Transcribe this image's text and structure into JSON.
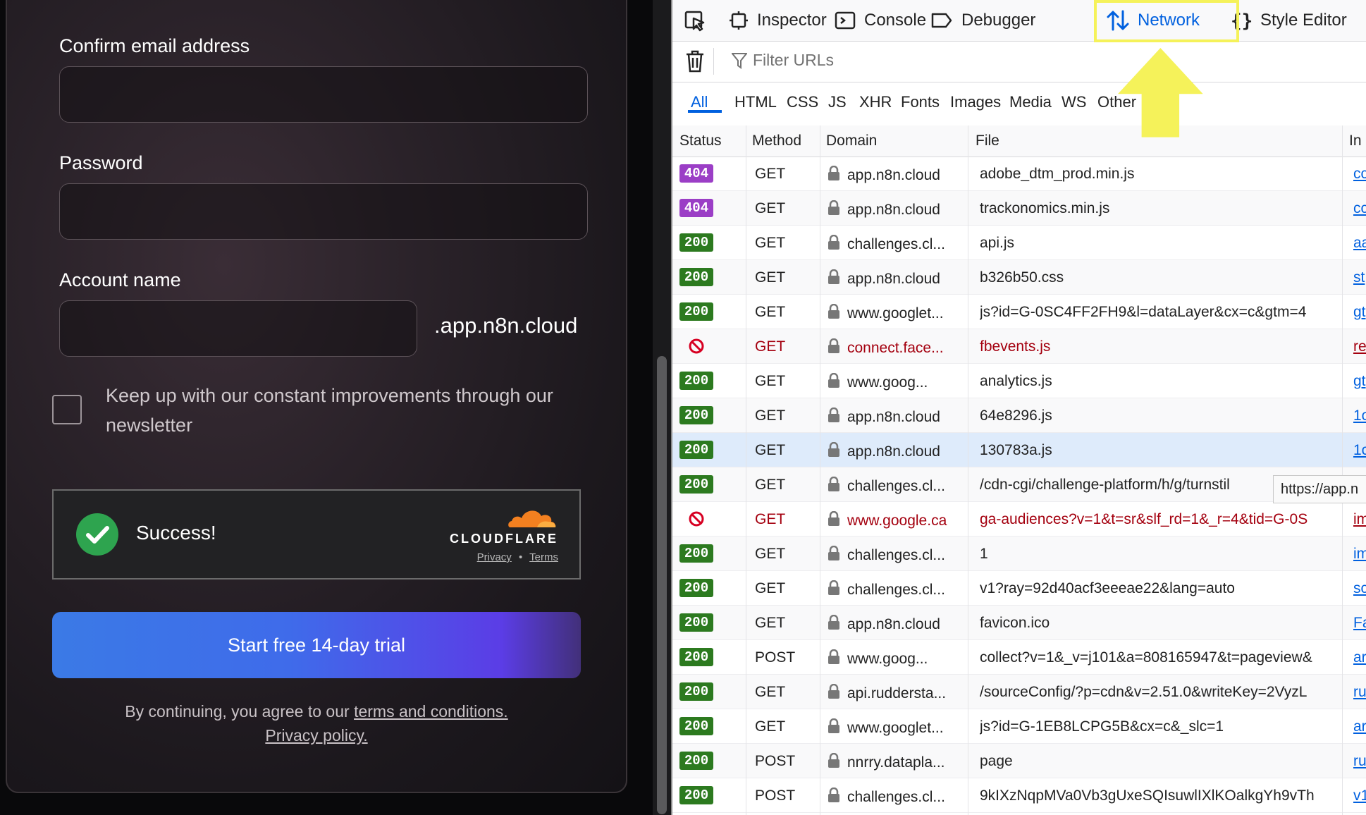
{
  "signup": {
    "confirm_email_label": "Confirm email address",
    "password_label": "Password",
    "account_name_label": "Account name",
    "account_suffix": ".app.n8n.cloud",
    "newsletter_text": "Keep up with our constant improvements through our newsletter",
    "captcha": {
      "status": "Success!",
      "brand": "CLOUDFLARE",
      "privacy": "Privacy",
      "separator": "•",
      "terms": "Terms"
    },
    "submit_label": "Start free 14-day trial",
    "agree_prefix": "By continuing, you agree to our",
    "terms_link": "terms and conditions.",
    "privacy_link": "Privacy policy."
  },
  "devtools": {
    "tabs": {
      "inspector": "Inspector",
      "console": "Console",
      "debugger": "Debugger",
      "network": "Network",
      "style_editor": "Style Editor"
    },
    "filter_placeholder": "Filter URLs",
    "types": {
      "all": "All",
      "html": "HTML",
      "css": "CSS",
      "js": "JS",
      "xhr": "XHR",
      "fonts": "Fonts",
      "images": "Images",
      "media": "Media",
      "ws": "WS",
      "other": "Other"
    },
    "columns": {
      "status": "Status",
      "method": "Method",
      "domain": "Domain",
      "file": "File",
      "initiator": "In"
    },
    "tooltip": "https://app.n",
    "requests": [
      {
        "status": "404",
        "method": "GET",
        "domain": "app.n8n.cloud",
        "file": "adobe_dtm_prod.min.js",
        "initiator": "cc"
      },
      {
        "status": "404",
        "method": "GET",
        "domain": "app.n8n.cloud",
        "file": "trackonomics.min.js",
        "initiator": "cc"
      },
      {
        "status": "200",
        "method": "GET",
        "domain": "challenges.cl...",
        "file": "api.js",
        "initiator": "aa"
      },
      {
        "status": "200",
        "method": "GET",
        "domain": "app.n8n.cloud",
        "file": "b326b50.css",
        "initiator": "st"
      },
      {
        "status": "200",
        "method": "GET",
        "domain": "www.googlet...",
        "file": "js?id=G-0SC4FF2FH9&l=dataLayer&cx=c&gtm=4",
        "initiator": "gt"
      },
      {
        "status": "blocked",
        "method": "GET",
        "domain": "connect.face...",
        "file": "fbevents.js",
        "initiator": "re"
      },
      {
        "status": "200",
        "method": "GET",
        "domain": "www.goog...",
        "file": "analytics.js",
        "initiator": "gt"
      },
      {
        "status": "200",
        "method": "GET",
        "domain": "app.n8n.cloud",
        "file": "64e8296.js",
        "initiator": "1c"
      },
      {
        "status": "200",
        "method": "GET",
        "domain": "app.n8n.cloud",
        "file": "130783a.js",
        "initiator": "1c"
      },
      {
        "status": "200",
        "method": "GET",
        "domain": "challenges.cl...",
        "file": "/cdn-cgi/challenge-platform/h/g/turnstil",
        "initiator": ""
      },
      {
        "status": "blocked",
        "method": "GET",
        "domain": "www.google.ca",
        "file": "ga-audiences?v=1&t=sr&slf_rd=1&_r=4&tid=G-0S",
        "initiator": "im"
      },
      {
        "status": "200",
        "method": "GET",
        "domain": "challenges.cl...",
        "file": "1",
        "initiator": "im"
      },
      {
        "status": "200",
        "method": "GET",
        "domain": "challenges.cl...",
        "file": "v1?ray=92d40acf3eeeae22&lang=auto",
        "initiator": "sc"
      },
      {
        "status": "200",
        "method": "GET",
        "domain": "app.n8n.cloud",
        "file": "favicon.ico",
        "initiator": "Fa"
      },
      {
        "status": "200",
        "method": "POST",
        "domain": "www.goog...",
        "file": "collect?v=1&_v=j101&a=808165947&t=pageview&",
        "initiator": "ar"
      },
      {
        "status": "200",
        "method": "GET",
        "domain": "api.ruddersta...",
        "file": "/sourceConfig/?p=cdn&v=2.51.0&writeKey=2VyzL",
        "initiator": "ru"
      },
      {
        "status": "200",
        "method": "GET",
        "domain": "www.googlet...",
        "file": "js?id=G-1EB8LCPG5B&cx=c&_slc=1",
        "initiator": "ar"
      },
      {
        "status": "200",
        "method": "POST",
        "domain": "nnrry.datapla...",
        "file": "page",
        "initiator": "ru"
      },
      {
        "status": "200",
        "method": "POST",
        "domain": "challenges.cl...",
        "file": "9kIXzNqpMVa0Vb3gUxeSQIsuwlIXlKOalkgYh9vTh",
        "initiator": "v1"
      }
    ]
  }
}
